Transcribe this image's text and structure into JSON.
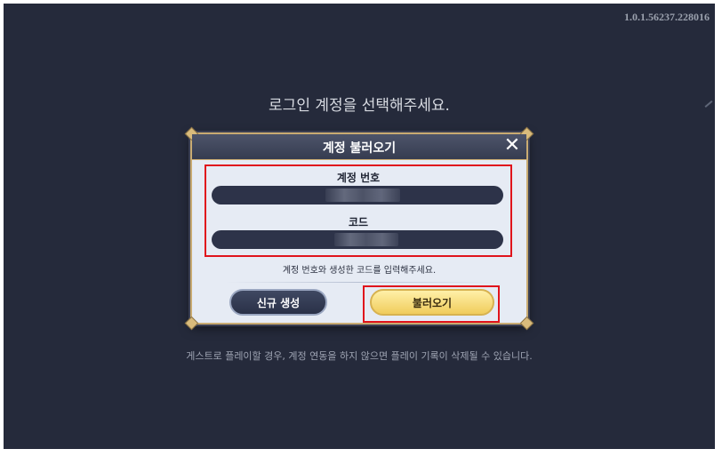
{
  "version": "1.0.1.56237.228016",
  "prompt": "로그인 계정을 선택해주세요.",
  "dialog": {
    "title": "계정 불러오기",
    "close_icon": "✕",
    "account_label": "계정 번호",
    "code_label": "코드",
    "hint": "계정 번호와 생성한 코드를 입력해주세요.",
    "new_button": "신규 생성",
    "load_button": "불러오기"
  },
  "warning": "게스트로 플레이할 경우, 계정 연동을 하지 않으면 플레이 기록이 삭제될 수 있습니다."
}
